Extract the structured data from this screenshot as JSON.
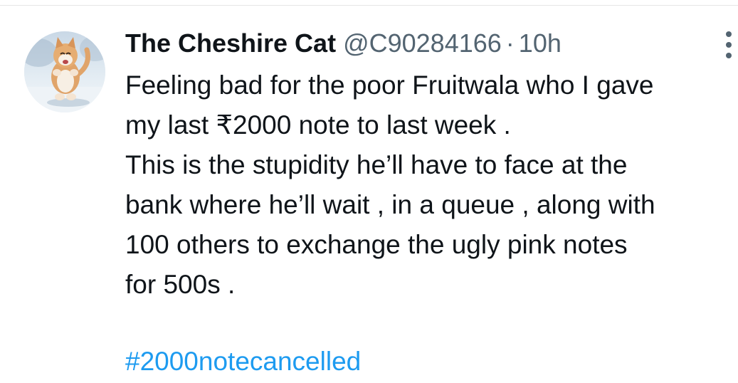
{
  "tweet": {
    "display_name": "The Cheshire Cat",
    "handle": "@C90284166",
    "separator": "·",
    "time": "10h",
    "body_lines": [
      "Feeling bad for the poor Fruitwala who I gave",
      "my last ₹2000 note to last week .",
      "This is the stupidity he’ll have to face at the",
      "bank where he’ll wait , in a queue , along with",
      "100 others to exchange the ugly pink notes",
      "for 500s ."
    ],
    "hashtag": "#2000notecancelled"
  },
  "colors": {
    "text": "#0f1419",
    "secondary": "#536471",
    "link": "#1d9bf0",
    "background": "#ffffff"
  },
  "icons": {
    "more": "more-vertical-icon",
    "avatar": "cat-avatar"
  }
}
